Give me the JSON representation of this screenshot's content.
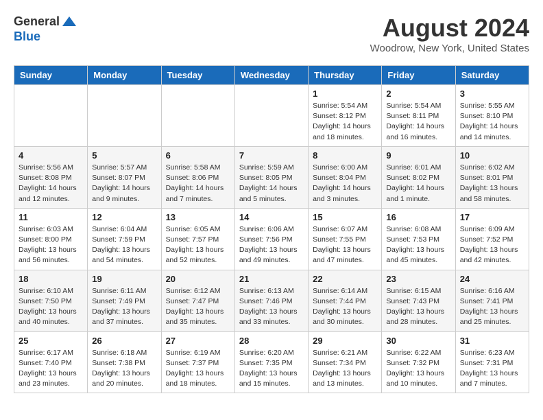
{
  "header": {
    "logo_general": "General",
    "logo_blue": "Blue",
    "month": "August 2024",
    "location": "Woodrow, New York, United States"
  },
  "days_of_week": [
    "Sunday",
    "Monday",
    "Tuesday",
    "Wednesday",
    "Thursday",
    "Friday",
    "Saturday"
  ],
  "weeks": [
    [
      {
        "day": "",
        "info": ""
      },
      {
        "day": "",
        "info": ""
      },
      {
        "day": "",
        "info": ""
      },
      {
        "day": "",
        "info": ""
      },
      {
        "day": "1",
        "info": "Sunrise: 5:54 AM\nSunset: 8:12 PM\nDaylight: 14 hours and 18 minutes."
      },
      {
        "day": "2",
        "info": "Sunrise: 5:54 AM\nSunset: 8:11 PM\nDaylight: 14 hours and 16 minutes."
      },
      {
        "day": "3",
        "info": "Sunrise: 5:55 AM\nSunset: 8:10 PM\nDaylight: 14 hours and 14 minutes."
      }
    ],
    [
      {
        "day": "4",
        "info": "Sunrise: 5:56 AM\nSunset: 8:08 PM\nDaylight: 14 hours and 12 minutes."
      },
      {
        "day": "5",
        "info": "Sunrise: 5:57 AM\nSunset: 8:07 PM\nDaylight: 14 hours and 9 minutes."
      },
      {
        "day": "6",
        "info": "Sunrise: 5:58 AM\nSunset: 8:06 PM\nDaylight: 14 hours and 7 minutes."
      },
      {
        "day": "7",
        "info": "Sunrise: 5:59 AM\nSunset: 8:05 PM\nDaylight: 14 hours and 5 minutes."
      },
      {
        "day": "8",
        "info": "Sunrise: 6:00 AM\nSunset: 8:04 PM\nDaylight: 14 hours and 3 minutes."
      },
      {
        "day": "9",
        "info": "Sunrise: 6:01 AM\nSunset: 8:02 PM\nDaylight: 14 hours and 1 minute."
      },
      {
        "day": "10",
        "info": "Sunrise: 6:02 AM\nSunset: 8:01 PM\nDaylight: 13 hours and 58 minutes."
      }
    ],
    [
      {
        "day": "11",
        "info": "Sunrise: 6:03 AM\nSunset: 8:00 PM\nDaylight: 13 hours and 56 minutes."
      },
      {
        "day": "12",
        "info": "Sunrise: 6:04 AM\nSunset: 7:59 PM\nDaylight: 13 hours and 54 minutes."
      },
      {
        "day": "13",
        "info": "Sunrise: 6:05 AM\nSunset: 7:57 PM\nDaylight: 13 hours and 52 minutes."
      },
      {
        "day": "14",
        "info": "Sunrise: 6:06 AM\nSunset: 7:56 PM\nDaylight: 13 hours and 49 minutes."
      },
      {
        "day": "15",
        "info": "Sunrise: 6:07 AM\nSunset: 7:55 PM\nDaylight: 13 hours and 47 minutes."
      },
      {
        "day": "16",
        "info": "Sunrise: 6:08 AM\nSunset: 7:53 PM\nDaylight: 13 hours and 45 minutes."
      },
      {
        "day": "17",
        "info": "Sunrise: 6:09 AM\nSunset: 7:52 PM\nDaylight: 13 hours and 42 minutes."
      }
    ],
    [
      {
        "day": "18",
        "info": "Sunrise: 6:10 AM\nSunset: 7:50 PM\nDaylight: 13 hours and 40 minutes."
      },
      {
        "day": "19",
        "info": "Sunrise: 6:11 AM\nSunset: 7:49 PM\nDaylight: 13 hours and 37 minutes."
      },
      {
        "day": "20",
        "info": "Sunrise: 6:12 AM\nSunset: 7:47 PM\nDaylight: 13 hours and 35 minutes."
      },
      {
        "day": "21",
        "info": "Sunrise: 6:13 AM\nSunset: 7:46 PM\nDaylight: 13 hours and 33 minutes."
      },
      {
        "day": "22",
        "info": "Sunrise: 6:14 AM\nSunset: 7:44 PM\nDaylight: 13 hours and 30 minutes."
      },
      {
        "day": "23",
        "info": "Sunrise: 6:15 AM\nSunset: 7:43 PM\nDaylight: 13 hours and 28 minutes."
      },
      {
        "day": "24",
        "info": "Sunrise: 6:16 AM\nSunset: 7:41 PM\nDaylight: 13 hours and 25 minutes."
      }
    ],
    [
      {
        "day": "25",
        "info": "Sunrise: 6:17 AM\nSunset: 7:40 PM\nDaylight: 13 hours and 23 minutes."
      },
      {
        "day": "26",
        "info": "Sunrise: 6:18 AM\nSunset: 7:38 PM\nDaylight: 13 hours and 20 minutes."
      },
      {
        "day": "27",
        "info": "Sunrise: 6:19 AM\nSunset: 7:37 PM\nDaylight: 13 hours and 18 minutes."
      },
      {
        "day": "28",
        "info": "Sunrise: 6:20 AM\nSunset: 7:35 PM\nDaylight: 13 hours and 15 minutes."
      },
      {
        "day": "29",
        "info": "Sunrise: 6:21 AM\nSunset: 7:34 PM\nDaylight: 13 hours and 13 minutes."
      },
      {
        "day": "30",
        "info": "Sunrise: 6:22 AM\nSunset: 7:32 PM\nDaylight: 13 hours and 10 minutes."
      },
      {
        "day": "31",
        "info": "Sunrise: 6:23 AM\nSunset: 7:31 PM\nDaylight: 13 hours and 7 minutes."
      }
    ]
  ]
}
